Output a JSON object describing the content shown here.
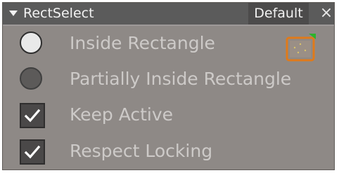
{
  "titlebar": {
    "collapse_icon": "triangle-down-icon",
    "title": "RectSelect",
    "preset_label": "Default",
    "close_label": "×"
  },
  "options": [
    {
      "label": "Inside Rectangle",
      "control": "radio",
      "selected": true
    },
    {
      "label": "Partially Inside Rectangle",
      "control": "radio",
      "selected": false
    },
    {
      "label": "Keep Active",
      "control": "checkbox",
      "checked": true
    },
    {
      "label": "Respect Locking",
      "control": "checkbox",
      "checked": true
    }
  ],
  "icons": {
    "mode_icon": "rect-select-mode-icon",
    "check_icon": "checkmark-icon"
  },
  "colors": {
    "panel_bg": "#8e8986",
    "titlebar_bg": "#5b5b5b",
    "label_text": "#cdcac8",
    "accent_orange": "#e07a1a",
    "accent_green": "#2cb32c"
  }
}
